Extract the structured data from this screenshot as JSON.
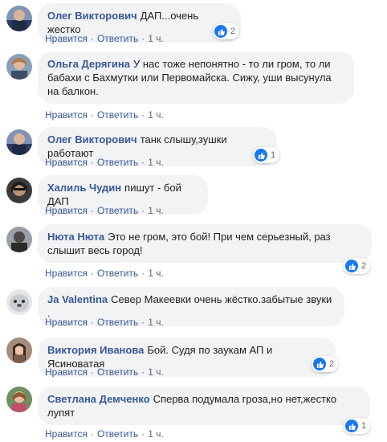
{
  "labels": {
    "like": "Нравится",
    "reply": "Ответить",
    "dot": "·"
  },
  "colors": {
    "author": "#385898",
    "bubble_bg": "#f2f3f5",
    "like_blue": "#1877f2",
    "meta": "#606770"
  },
  "comments": [
    {
      "author": "Олег Викторович",
      "text": "ДАП...очень жестко",
      "time": "1 ч.",
      "reactions": "2",
      "avatar": "avatar-photo"
    },
    {
      "author": "Ольга Дерягина",
      "text": "У нас тоже непонятно - то ли гром, то ли бабахи с Бахмутки или Первомайска. Сижу, уши высунула на балкон.",
      "time": "1 ч.",
      "reactions": "",
      "avatar": "avatar-photo"
    },
    {
      "author": "Олег Викторович",
      "text": "танк слышу,зушки работают",
      "time": "1 ч.",
      "reactions": "1",
      "avatar": "avatar-photo"
    },
    {
      "author": "Халиль Чудин",
      "text": "пишут - бой ДАП",
      "time": "1 ч.",
      "reactions": "",
      "avatar": "avatar-photo"
    },
    {
      "author": "Нюта Нюта",
      "text": "Это не гром, это бой! При чем серьезный, раз слышит весь город!",
      "time": "1 ч.",
      "reactions": "2",
      "avatar": "avatar-photo"
    },
    {
      "author": "Ja Valentina",
      "text": "Север Макеевки очень жёстко.забытые звуки .",
      "time": "1 ч.",
      "reactions": "",
      "avatar": "seal-avatar"
    },
    {
      "author": "Виктория Иванова",
      "text": "Бой. Судя по заукам АП и Ясиноватая",
      "time": "1 ч.",
      "reactions": "2",
      "avatar": "avatar-photo"
    },
    {
      "author": "Светлана Демченко",
      "text": "Сперва подумала гроза,но нет,жестко лупят",
      "time": "1 ч.",
      "reactions": "1",
      "avatar": "avatar-photo"
    }
  ]
}
